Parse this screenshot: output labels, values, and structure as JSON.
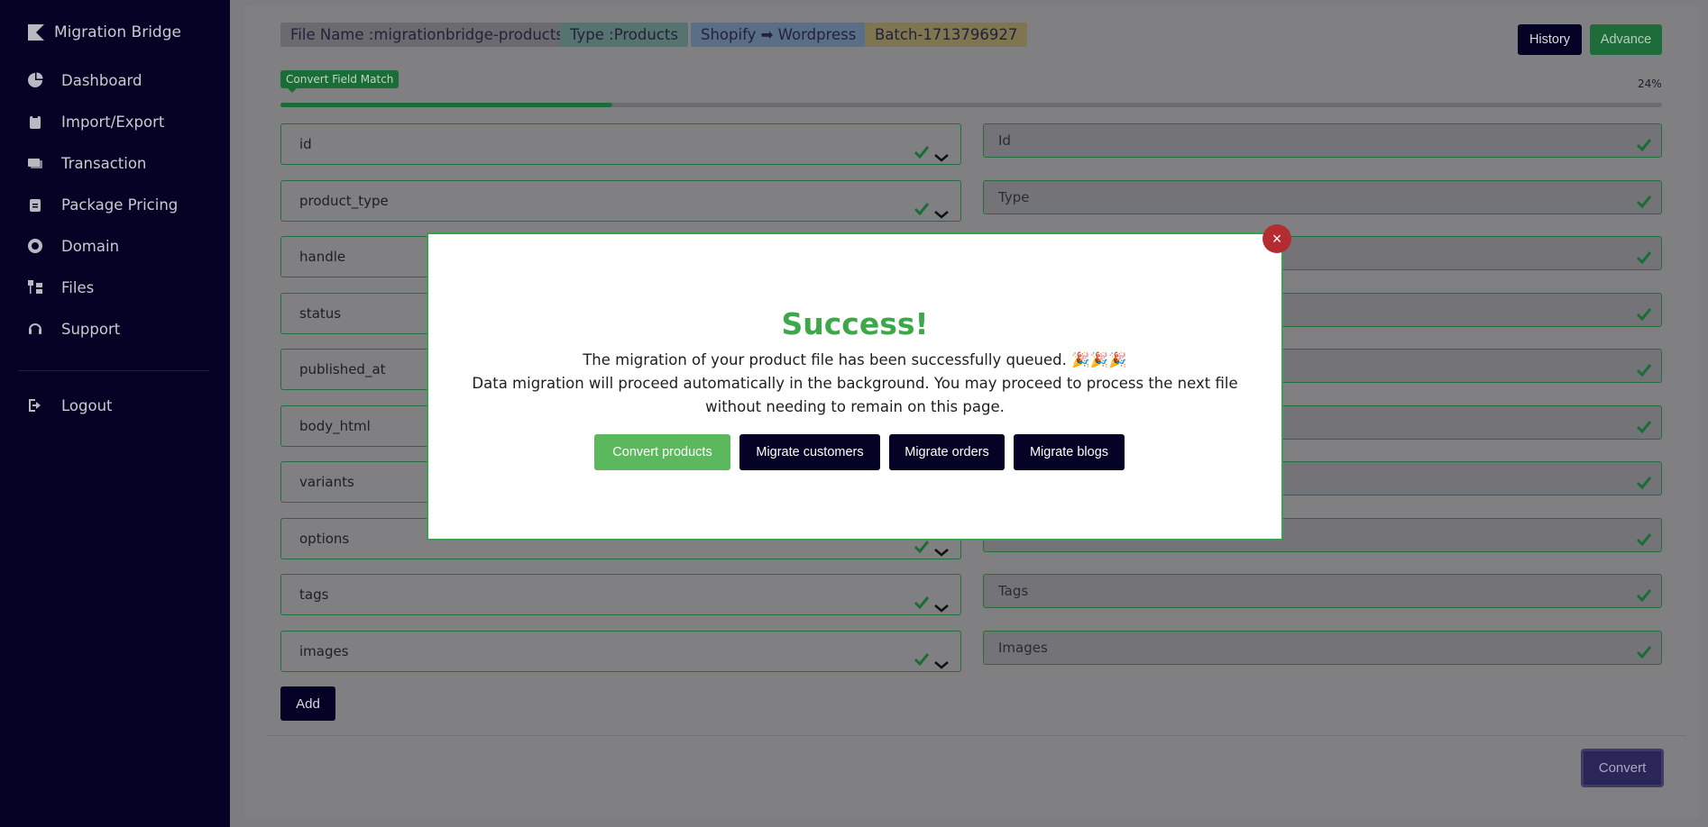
{
  "sidebar": {
    "brand": "Migration Bridge",
    "items": [
      {
        "label": "Dashboard",
        "icon": "pie-chart-icon"
      },
      {
        "label": "Import/Export",
        "icon": "clipboard-icon"
      },
      {
        "label": "Transaction",
        "icon": "money-icon"
      },
      {
        "label": "Package Pricing",
        "icon": "clipboard-list-icon"
      },
      {
        "label": "Domain",
        "icon": "globe-icon"
      },
      {
        "label": "Files",
        "icon": "folder-tree-icon"
      },
      {
        "label": "Support",
        "icon": "headset-icon"
      }
    ],
    "logout": "Logout"
  },
  "header": {
    "file_name": "File Name :migrationbridge-products",
    "type": "Type :Products",
    "route": "Shopify ➡ Wordpress",
    "batch": "Batch-1713796927",
    "history_label": "History",
    "advance_label": "Advance"
  },
  "progress": {
    "label": "Convert Field Match",
    "percent_text": "24%",
    "fraction": 0.24
  },
  "fields": [
    {
      "source": "id",
      "target": "Id"
    },
    {
      "source": "product_type",
      "target": "Type"
    },
    {
      "source": "handle",
      "target": ""
    },
    {
      "source": "status",
      "target": ""
    },
    {
      "source": "published_at",
      "target": ""
    },
    {
      "source": "body_html",
      "target": ""
    },
    {
      "source": "variants",
      "target": ""
    },
    {
      "source": "options",
      "target": ""
    },
    {
      "source": "tags",
      "target": "Tags"
    },
    {
      "source": "images",
      "target": "Images"
    }
  ],
  "add_label": "Add",
  "convert_label": "Convert",
  "modal": {
    "title": "Success!",
    "line1": "The migration of your product file has been successfully queued. 🎉🎉🎉",
    "line2": "Data migration will proceed automatically in the background. You may proceed to process the next file",
    "line3": "without needing to remain on this page.",
    "close_label": "×",
    "buttons": {
      "products": "Convert products",
      "customers": "Migrate customers",
      "orders": "Migrate orders",
      "blogs": "Migrate blogs"
    }
  },
  "colors": {
    "sidebar_bg": "#050325",
    "accent_green": "#37a24b",
    "success_title": "#3ca84a",
    "danger": "#b52b32"
  }
}
